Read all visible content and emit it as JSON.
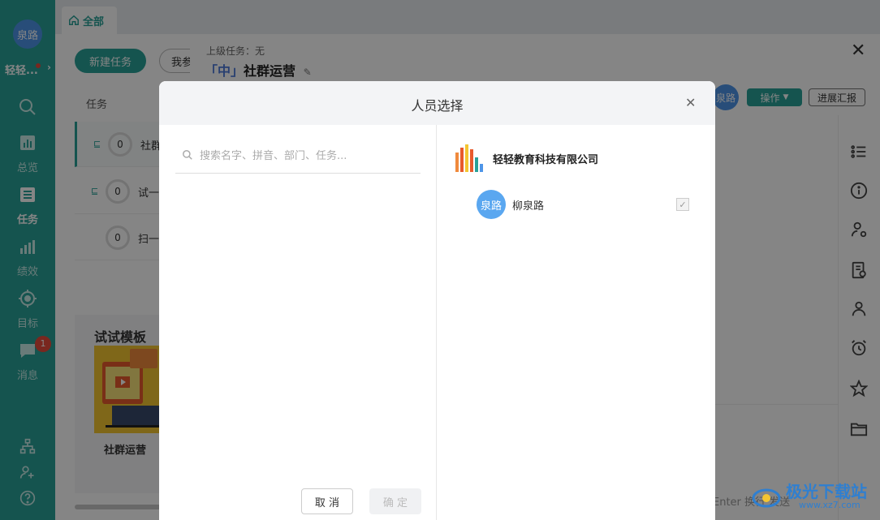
{
  "sidebar": {
    "avatar_text": "泉路",
    "org_short": "轻轻...",
    "items": [
      {
        "icon": "search-icon",
        "label": ""
      },
      {
        "icon": "overview-icon",
        "label": "总览"
      },
      {
        "icon": "task-icon",
        "label": "任务"
      },
      {
        "icon": "performance-icon",
        "label": "绩效"
      },
      {
        "icon": "target-icon",
        "label": "目标"
      },
      {
        "icon": "message-icon",
        "label": "消息"
      }
    ],
    "message_badge": "1"
  },
  "tabs": {
    "all": "全部"
  },
  "toolbar": {
    "new_task": "新建任务",
    "mine": "我参"
  },
  "task_list": {
    "header": "任务",
    "rows": [
      {
        "count": "0",
        "name": "社群"
      },
      {
        "count": "0",
        "name": "试一"
      },
      {
        "count": "0",
        "name": "扫一"
      }
    ]
  },
  "templates": {
    "title": "试试模板",
    "card_name": "社群运营"
  },
  "drawer": {
    "parent_task": "上级任务：无",
    "priority": "「中」",
    "task_name": "社群运营",
    "avatar_text": "泉路",
    "operate_label": "操作",
    "progress_label": "进展汇报",
    "enter_hint": "Enter 换行    发送"
  },
  "modal": {
    "title": "人员选择",
    "search_placeholder": "搜索名字、拼音、部门、任务...",
    "cancel_label": "取 消",
    "confirm_label": "确 定",
    "org_name": "轻轻教育科技有限公司",
    "members": [
      {
        "avatar_text": "泉路",
        "name": "柳泉路",
        "checked": true
      }
    ]
  },
  "watermark": {
    "title": "极光下载站",
    "url": "www.xz7.com"
  },
  "colors": {
    "accent": "#2aa198",
    "avatar_blue": "#4e95e8",
    "badge_red": "#e84b3c"
  }
}
